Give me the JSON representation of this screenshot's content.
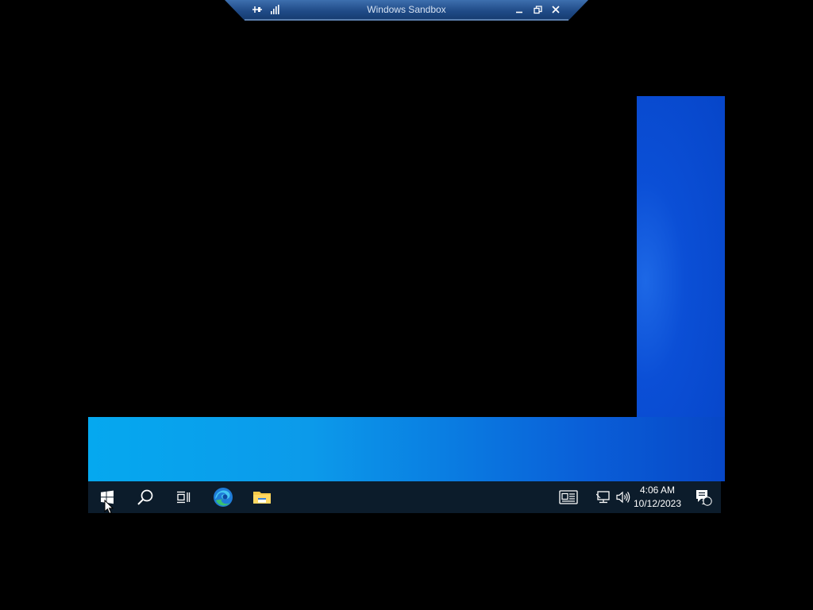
{
  "connection_bar": {
    "title": "Windows Sandbox",
    "pin_icon": "pin-icon",
    "signal_icon": "signal-icon",
    "buttons": [
      "minimize-icon",
      "restore-icon",
      "close-icon"
    ]
  },
  "desktop": {
    "wallpaper_colors": [
      "#05a8ef",
      "#0a7fe2",
      "#0645c8"
    ]
  },
  "taskbar": {
    "background": "#0c1c2b",
    "items": [
      "windows-start-icon",
      "search-icon",
      "task-view-icon",
      "edge-icon",
      "file-explorer-icon"
    ],
    "tray": {
      "news_icon": "news-widget-icon",
      "network_icon": "network-icon",
      "volume_icon": "volume-icon",
      "time": "4:06 AM",
      "date": "10/12/2023",
      "notification_count": "1"
    }
  }
}
